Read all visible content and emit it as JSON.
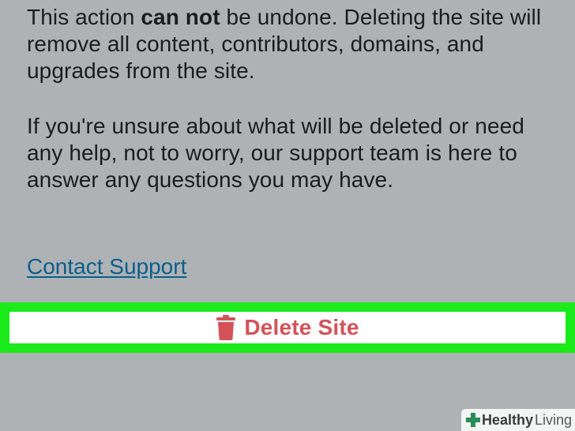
{
  "warning": {
    "p1_before": "This action ",
    "p1_bold": "can not",
    "p1_after": " be undone. Deleting the site will remove all content, contributors, domains, and upgrades from the site.",
    "p2": "If you're unsure about what will be deleted or need any help, not to worry, our support team is here to answer any questions you may have."
  },
  "contact_link": "Contact Support",
  "delete_button": {
    "label": "Delete Site",
    "icon": "trash-icon"
  },
  "watermark": {
    "part1": "Healthy",
    "part2": "Living"
  },
  "colors": {
    "background": "#aeb2b5",
    "highlight": "#1bea1b",
    "danger": "#d25258",
    "link": "#0a5f8c"
  }
}
